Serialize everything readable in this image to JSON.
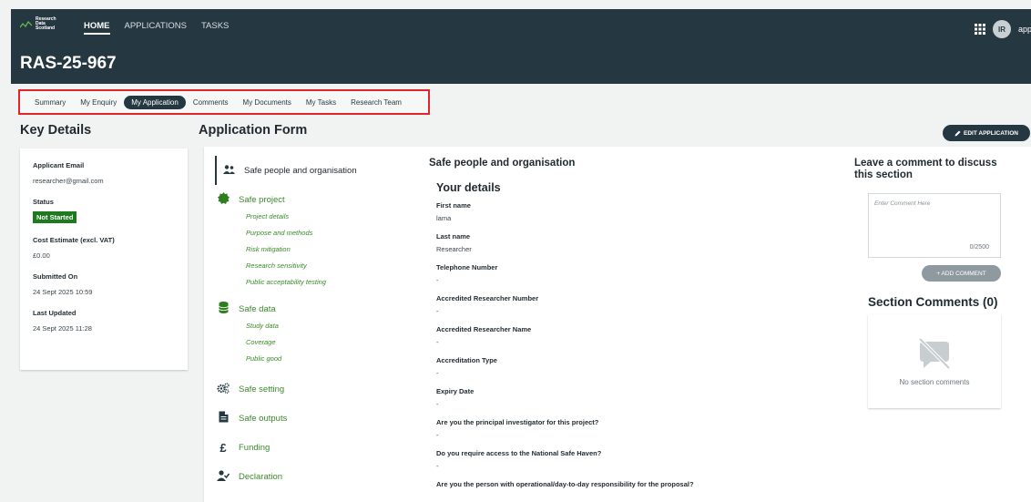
{
  "header": {
    "logo_lines": [
      "Research",
      "Data",
      "Scotland"
    ],
    "nav": [
      "HOME",
      "APPLICATIONS",
      "TASKS"
    ],
    "title": "RAS-25-967",
    "avatar_initials": "IR",
    "user_label": "appl"
  },
  "tabs": [
    "Summary",
    "My Enquiry",
    "My Application",
    "Comments",
    "My Documents",
    "My Tasks",
    "Research Team"
  ],
  "key_details": {
    "heading": "Key Details",
    "email_label": "Applicant Email",
    "email": "researcher@gmail.com",
    "status_label": "Status",
    "status": "Not Started",
    "cost_label": "Cost Estimate (excl. VAT)",
    "cost": "£0.00",
    "submitted_label": "Submitted On",
    "submitted": "24 Sept 2025 10:59",
    "updated_label": "Last Updated",
    "updated": "24 Sept 2025 11:28"
  },
  "form": {
    "heading": "Application Form",
    "edit_label": "EDIT APPLICATION",
    "nav": {
      "people": "Safe people and organisation",
      "project": "Safe project",
      "project_subs": [
        "Project details",
        "Purpose and methods",
        "Risk mitigation",
        "Research sensitivity",
        "Public acceptability testing"
      ],
      "data": "Safe data",
      "data_subs": [
        "Study data",
        "Coverage",
        "Public good"
      ],
      "setting": "Safe setting",
      "outputs": "Safe outputs",
      "funding": "Funding",
      "declaration": "Declaration"
    },
    "content_title": "Safe people and organisation",
    "content_subtitle": "Your details",
    "fields": [
      {
        "label": "First name",
        "value": "lama"
      },
      {
        "label": "Last name",
        "value": "Researcher"
      },
      {
        "label": "Telephone Number",
        "value": "-"
      },
      {
        "label": "Accredited Researcher Number",
        "value": "-"
      },
      {
        "label": "Accredited Researcher Name",
        "value": "-"
      },
      {
        "label": "Accreditation Type",
        "value": "-"
      },
      {
        "label": "Expiry Date",
        "value": "-"
      },
      {
        "label": "Are you the principal investigator for this project?",
        "value": "-"
      },
      {
        "label": "Do you require access to the National Safe Haven?",
        "value": "-"
      },
      {
        "label": "Are you the person with operational/day-to-day responsibility for the proposal?",
        "value": ""
      }
    ]
  },
  "comments": {
    "title": "Leave a comment to discuss this section",
    "placeholder": "Enter Comment Here",
    "count": "0/2500",
    "add_label": "+ ADD COMMENT",
    "section_title": "Section Comments (0)",
    "empty": "No section comments"
  }
}
